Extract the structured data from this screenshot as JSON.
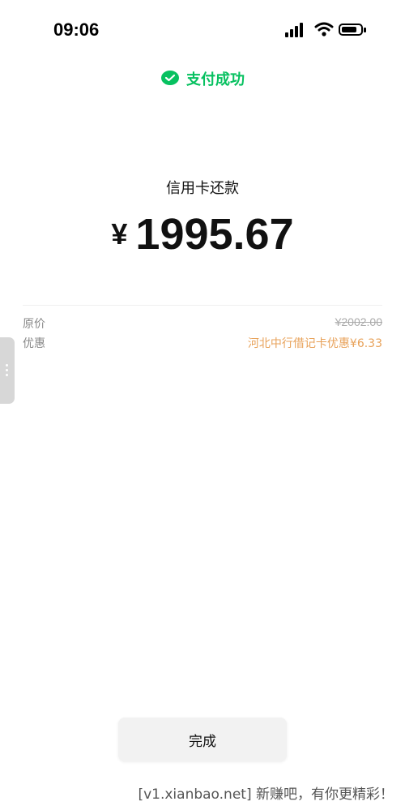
{
  "status_bar": {
    "time": "09:06",
    "icons": [
      "signal-icon",
      "wifi-icon",
      "battery-icon"
    ]
  },
  "header": {
    "icon": "wechat-pay-icon",
    "status_text": "支付成功",
    "accent_color": "#07c160"
  },
  "payment": {
    "title": "信用卡还款",
    "currency_symbol": "¥",
    "amount": "1995.67"
  },
  "details": {
    "original_label": "原价",
    "original_value": "¥2002.00",
    "discount_label": "优惠",
    "discount_value": "河北中行借记卡优惠¥6.33",
    "discount_color": "#e8a25a"
  },
  "actions": {
    "done_label": "完成"
  },
  "watermark": "[v1.xianbao.net] 新赚吧，有你更精彩！"
}
